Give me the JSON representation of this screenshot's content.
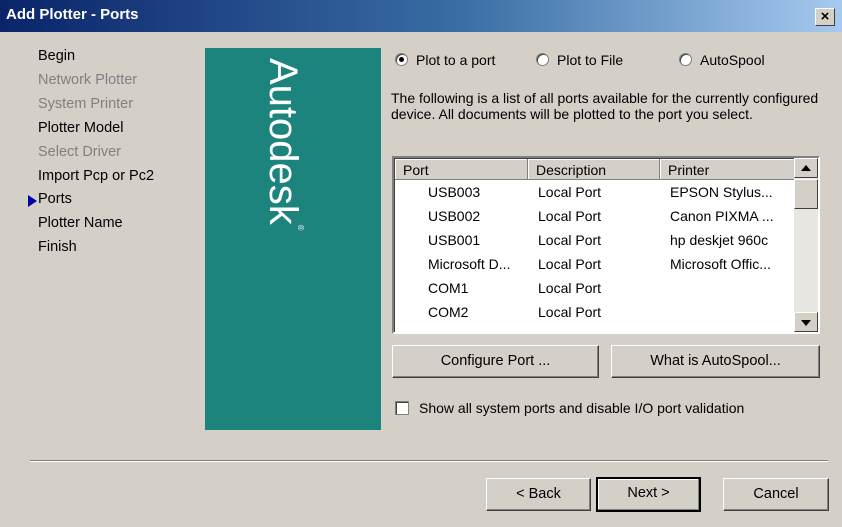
{
  "window": {
    "title": "Add Plotter - Ports",
    "close_label": "×"
  },
  "nav": {
    "steps": [
      {
        "label": "Begin",
        "enabled": true
      },
      {
        "label": "Network Plotter",
        "enabled": false
      },
      {
        "label": "System Printer",
        "enabled": false
      },
      {
        "label": "Plotter Model",
        "enabled": true
      },
      {
        "label": "Select Driver",
        "enabled": false
      },
      {
        "label": "Import Pcp or Pc2",
        "enabled": true
      },
      {
        "label": "Ports",
        "enabled": true,
        "current": true
      },
      {
        "label": "Plotter Name",
        "enabled": true
      },
      {
        "label": "Finish",
        "enabled": true
      }
    ]
  },
  "banner": {
    "logo_text": "Autodesk",
    "logo_mark": "®",
    "background": "#1d837d"
  },
  "plot_mode": {
    "options": [
      "Plot to a port",
      "Plot to File",
      "AutoSpool"
    ],
    "selected": "Plot to a port"
  },
  "description": "The following is a list of all ports available for the currently configured device. All documents will be plotted to the port you select.",
  "ports_table": {
    "columns": [
      "Port",
      "Description",
      "Printer"
    ],
    "rows": [
      [
        "USB003",
        "Local Port",
        "EPSON Stylus..."
      ],
      [
        "USB002",
        "Local Port",
        "Canon PIXMA ..."
      ],
      [
        "USB001",
        "Local Port",
        "hp deskjet 960c"
      ],
      [
        "Microsoft D...",
        "Local Port",
        "Microsoft Offic..."
      ],
      [
        "COM1",
        "Local Port",
        ""
      ],
      [
        "COM2",
        "Local Port",
        ""
      ]
    ]
  },
  "buttons": {
    "configure_port": "Configure Port ...",
    "what_is_autospool": "What is AutoSpool...",
    "back": "< Back",
    "next": "Next >",
    "cancel": "Cancel"
  },
  "show_all_ports": {
    "label": "Show all system ports and disable I/O port validation",
    "checked": false
  }
}
